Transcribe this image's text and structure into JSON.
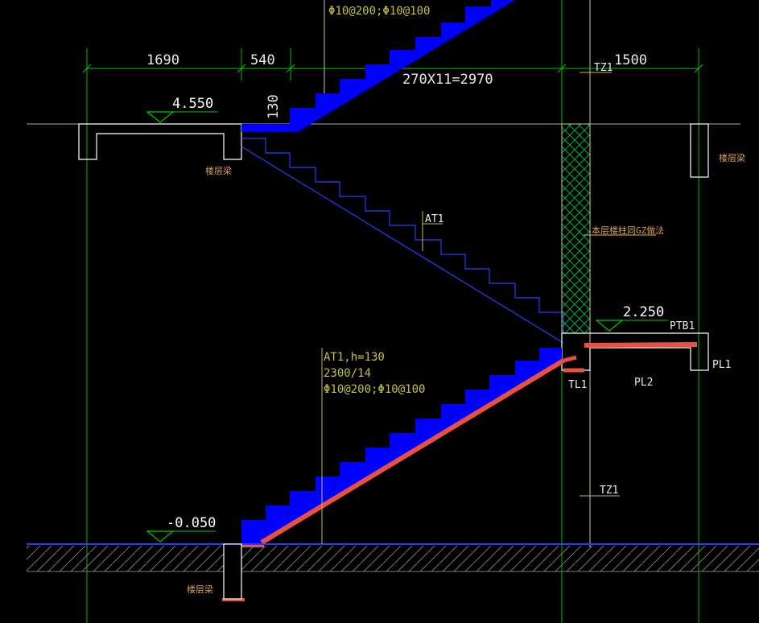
{
  "dimensions": {
    "left": "1690",
    "middle": "540",
    "flight": "270X11=2970",
    "right": "1500",
    "thickness": "130"
  },
  "levels": {
    "upper": "4.550",
    "landing": "2.250",
    "ground": "-0.050"
  },
  "labels": {
    "at1_upper": "AT1",
    "at1_lower_line1": "AT1,h=130",
    "at1_lower_line2": "2300/14",
    "at1_lower_line3": "Φ10@200;Φ10@100",
    "top_rebar": "Φ10@200;Φ10@100",
    "tz1_top": "TZ1",
    "tz1_bottom": "TZ1",
    "ptb1": "PTB1",
    "pl1": "PL1",
    "pl2": "PL2",
    "tl1": "TL1",
    "column_note": "本层楼柱同GZ做法",
    "floor_beam_top_left": "楼层梁",
    "floor_beam_right": "楼层梁",
    "floor_beam_bottom": "楼层梁"
  },
  "colors": {
    "background": "#000000",
    "stair_fill": "#0000ff",
    "highlight": "#e85040",
    "dimension_line": "#00cc00",
    "outline": "#ffffff",
    "annotation": "#c8c040",
    "hatch": "#00aa44",
    "ground_hatch": "#888888"
  }
}
